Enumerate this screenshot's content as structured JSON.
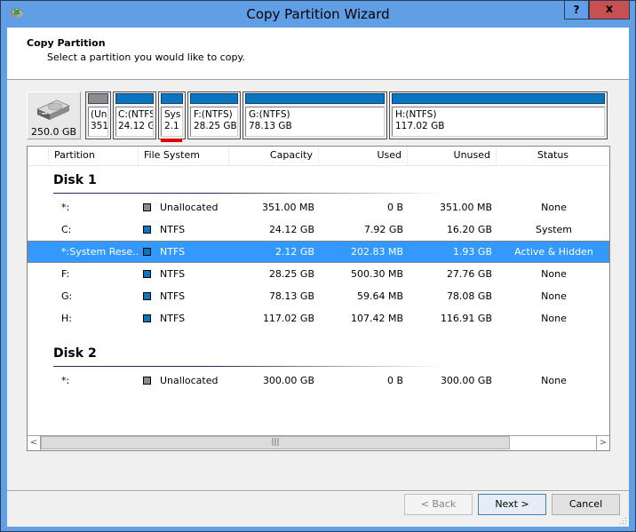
{
  "window": {
    "title": "Copy Partition Wizard",
    "help_label": "?",
    "close_label": "x"
  },
  "header": {
    "title": "Copy Partition",
    "subtitle": "Select a partition you would like to copy."
  },
  "disk_map": {
    "disk_capacity": "250.0 GB",
    "partitions": [
      {
        "line1": "(Un",
        "line2": "351",
        "type": "unallocated"
      },
      {
        "line1": "C:(NTFS",
        "line2": "24.12 G",
        "type": "ntfs"
      },
      {
        "line1": "Sys",
        "line2": "2.1",
        "type": "ntfs",
        "selected": true
      },
      {
        "line1": "F:(NTFS)",
        "line2": "28.25 GB",
        "type": "ntfs"
      },
      {
        "line1": "G:(NTFS)",
        "line2": "78.13 GB",
        "type": "ntfs"
      },
      {
        "line1": "H:(NTFS)",
        "line2": "117.02 GB",
        "type": "ntfs"
      }
    ]
  },
  "list": {
    "columns": [
      "Partition",
      "File System",
      "Capacity",
      "Used",
      "Unused",
      "Status"
    ],
    "groups": [
      {
        "title": "Disk 1",
        "rows": [
          {
            "partition": "*:",
            "fs": "Unallocated",
            "fs_color": "#8c8c8c",
            "capacity": "351.00 MB",
            "used": "0 B",
            "unused": "351.00 MB",
            "status": "None"
          },
          {
            "partition": "C:",
            "fs": "NTFS",
            "fs_color": "#0a76c0",
            "capacity": "24.12 GB",
            "used": "7.92 GB",
            "unused": "16.20 GB",
            "status": "System"
          },
          {
            "partition": "*:System Rese...",
            "fs": "NTFS",
            "fs_color": "#0a76c0",
            "capacity": "2.12 GB",
            "used": "202.83 MB",
            "unused": "1.93 GB",
            "status": "Active & Hidden",
            "selected": true
          },
          {
            "partition": "F:",
            "fs": "NTFS",
            "fs_color": "#0a76c0",
            "capacity": "28.25 GB",
            "used": "500.30 MB",
            "unused": "27.76 GB",
            "status": "None"
          },
          {
            "partition": "G:",
            "fs": "NTFS",
            "fs_color": "#0a76c0",
            "capacity": "78.13 GB",
            "used": "59.64 MB",
            "unused": "78.08 GB",
            "status": "None"
          },
          {
            "partition": "H:",
            "fs": "NTFS",
            "fs_color": "#0a76c0",
            "capacity": "117.02 GB",
            "used": "107.42 MB",
            "unused": "116.91 GB",
            "status": "None"
          }
        ]
      },
      {
        "title": "Disk 2",
        "rows": [
          {
            "partition": "*:",
            "fs": "Unallocated",
            "fs_color": "#8c8c8c",
            "capacity": "300.00 GB",
            "used": "0 B",
            "unused": "300.00 GB",
            "status": "None"
          }
        ]
      }
    ]
  },
  "scrollbar": {
    "left_arrow": "<",
    "right_arrow": ">",
    "thumb_grip": "|||"
  },
  "buttons": {
    "back": "< Back",
    "next": "Next >",
    "cancel": "Cancel"
  }
}
